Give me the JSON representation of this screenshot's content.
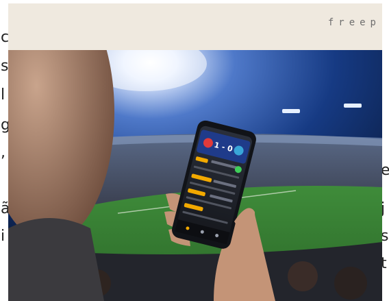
{
  "banner": {
    "text": "freep"
  },
  "left_fragments": [
    "c",
    "s",
    "l",
    "g",
    ",",
    "ã",
    "i"
  ],
  "right_fragments": [
    "e",
    "j",
    "s",
    "t"
  ],
  "photo": {
    "score": "1 - 0",
    "icons": [
      "home-team-badge-icon",
      "away-team-badge-icon",
      "home-icon",
      "search-icon",
      "menu-icon"
    ],
    "accent_color": "#f2a900",
    "pitch_color": "#3f8c3a"
  }
}
